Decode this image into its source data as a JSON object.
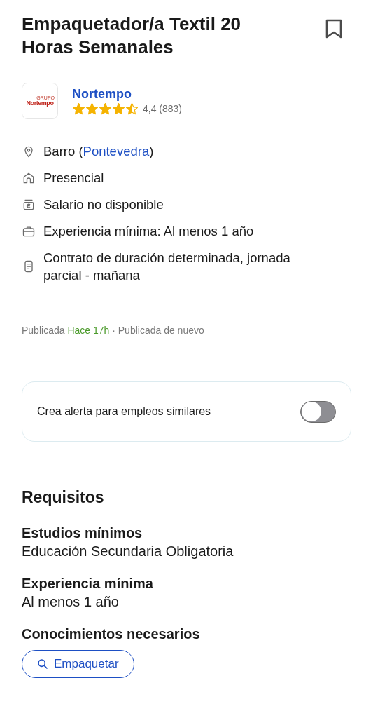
{
  "job": {
    "title": "Empaquetador/a Textil 20 Horas Semanales",
    "saved": false
  },
  "company": {
    "logo_top": "GRUPO",
    "logo_name": "Nortempo",
    "name": "Nortempo",
    "stars": 4.5,
    "rating": "4,4 (883)"
  },
  "details": [
    {
      "kind": "location",
      "text": "Barro (",
      "link": "Pontevedra",
      "suffix": ")"
    },
    {
      "kind": "workplace",
      "text": "Presencial"
    },
    {
      "kind": "salary",
      "text": "Salario no disponible"
    },
    {
      "kind": "experience",
      "text": "Experiencia mínima: Al menos 1 año"
    },
    {
      "kind": "contract",
      "text": "Contrato de duración determinada, jornada parcial - mañana"
    }
  ],
  "published": {
    "prefix": "Publicada",
    "time": "Hace 17h",
    "suffix": "· Publicada de nuevo"
  },
  "alert": {
    "label": "Crea alerta para empleos similares",
    "on": false
  },
  "requirements": {
    "heading": "Requisitos",
    "sections": [
      {
        "title": "Estudios mínimos",
        "value": "Educación Secundaria Obligatoria"
      },
      {
        "title": "Experiencia mínima",
        "value": "Al menos 1 año"
      },
      {
        "title": "Conocimientos necesarios",
        "tags": [
          "Empaquetar"
        ]
      }
    ]
  }
}
